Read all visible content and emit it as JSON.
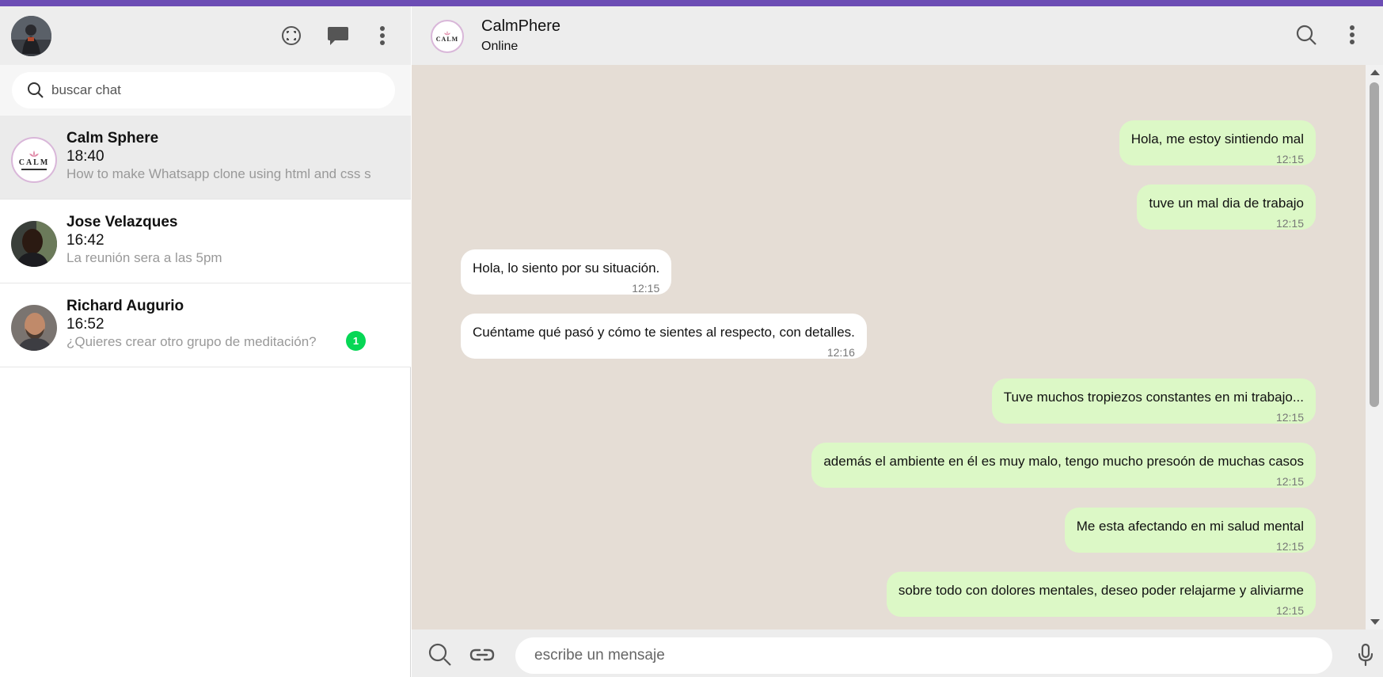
{
  "colors": {
    "accent": "#6c4db4",
    "outgoing_bubble": "#dcf8c6",
    "incoming_bubble": "#ffffff",
    "chat_background": "#e5ddd5",
    "unread_badge": "#06d755"
  },
  "left_header": {
    "icons": [
      "status-icon",
      "new-chat-icon",
      "more-vertical-icon"
    ]
  },
  "search": {
    "placeholder": "buscar chat"
  },
  "chats": [
    {
      "name": "Calm Sphere",
      "time": "18:40",
      "preview": "How to make Whatsapp clone using html and css s",
      "active": true,
      "unread": null,
      "logo_text": "CALM"
    },
    {
      "name": "Jose Velazques",
      "time": "16:42",
      "preview": "La reunión sera a las 5pm",
      "active": false,
      "unread": null
    },
    {
      "name": "Richard Augurio",
      "time": "16:52",
      "preview": "¿Quieres crear otro grupo de meditación?",
      "active": false,
      "unread": "1"
    }
  ],
  "conversation": {
    "contact_name": "CalmPhere",
    "status": "Online",
    "logo_text": "CALM",
    "header_icons": [
      "search-icon",
      "more-vertical-icon"
    ],
    "messages": [
      {
        "direction": "out",
        "text": "Hola, me estoy sintiendo mal",
        "time": "12:15"
      },
      {
        "direction": "out",
        "text": "tuve un mal dia de trabajo",
        "time": "12:15"
      },
      {
        "direction": "in",
        "text": "Hola, lo siento por su situación.",
        "time": "12:15"
      },
      {
        "direction": "in",
        "text": "Cuéntame qué pasó y cómo te sientes al respecto, con detalles.",
        "time": "12:16"
      },
      {
        "direction": "out",
        "text": "Tuve muchos tropiezos constantes en mi trabajo...",
        "time": "12:15"
      },
      {
        "direction": "out",
        "text": "además el ambiente en él es muy malo, tengo mucho presoón de muchas casos",
        "time": "12:15"
      },
      {
        "direction": "out",
        "text": "Me esta afectando en mi salud mental",
        "time": "12:15"
      },
      {
        "direction": "out",
        "text": "sobre todo con dolores mentales, deseo poder relajarme y aliviarme",
        "time": "12:15"
      }
    ]
  },
  "composer": {
    "placeholder": "escribe un mensaje",
    "icons": [
      "search-icon",
      "link-icon",
      "microphone-icon"
    ]
  }
}
